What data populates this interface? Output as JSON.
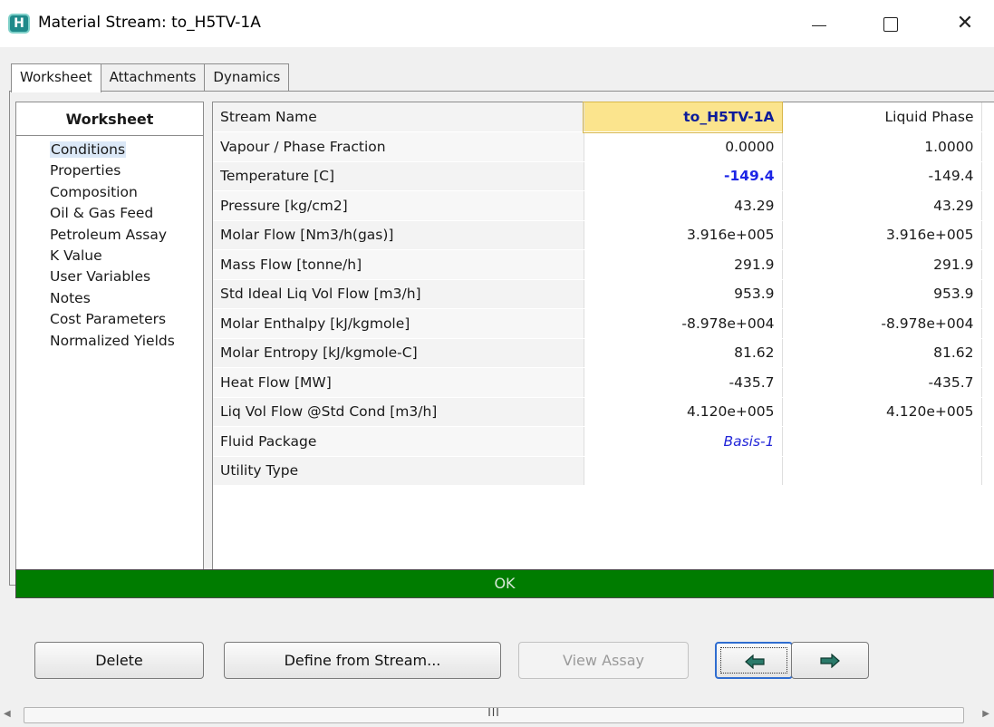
{
  "window": {
    "title": "Material Stream: to_H5TV-1A",
    "app_icon_letter": "H",
    "minimize_glyph": "",
    "maximize_glyph": "",
    "close_glyph": "✕"
  },
  "tabs": [
    {
      "label": "Worksheet",
      "active": true
    },
    {
      "label": "Attachments",
      "active": false
    },
    {
      "label": "Dynamics",
      "active": false
    }
  ],
  "nav": {
    "header": "Worksheet",
    "items": [
      {
        "label": "Conditions",
        "active": true
      },
      {
        "label": "Properties",
        "active": false
      },
      {
        "label": "Composition",
        "active": false
      },
      {
        "label": "Oil & Gas Feed",
        "active": false
      },
      {
        "label": "Petroleum Assay",
        "active": false
      },
      {
        "label": "K Value",
        "active": false
      },
      {
        "label": "User Variables",
        "active": false
      },
      {
        "label": "Notes",
        "active": false
      },
      {
        "label": "Cost Parameters",
        "active": false
      },
      {
        "label": "Normalized Yields",
        "active": false
      }
    ]
  },
  "grid": {
    "rows": [
      {
        "name": "Stream Name",
        "value": "to_H5TV-1A",
        "liquid": "Liquid Phase",
        "style": "selected"
      },
      {
        "name": "Vapour / Phase Fraction",
        "value": "0.0000",
        "liquid": "1.0000",
        "style": ""
      },
      {
        "name": "Temperature [C]",
        "value": "-149.4",
        "liquid": "-149.4",
        "style": "blue-bold"
      },
      {
        "name": "Pressure [kg/cm2]",
        "value": "43.29",
        "liquid": "43.29",
        "style": ""
      },
      {
        "name": "Molar Flow [Nm3/h(gas)]",
        "value": "3.916e+005",
        "liquid": "3.916e+005",
        "style": ""
      },
      {
        "name": "Mass Flow [tonne/h]",
        "value": "291.9",
        "liquid": "291.9",
        "style": ""
      },
      {
        "name": "Std Ideal Liq Vol Flow [m3/h]",
        "value": "953.9",
        "liquid": "953.9",
        "style": ""
      },
      {
        "name": "Molar Enthalpy [kJ/kgmole]",
        "value": "-8.978e+004",
        "liquid": "-8.978e+004",
        "style": ""
      },
      {
        "name": "Molar Entropy [kJ/kgmole-C]",
        "value": "81.62",
        "liquid": "81.62",
        "style": ""
      },
      {
        "name": "Heat Flow [MW]",
        "value": "-435.7",
        "liquid": "-435.7",
        "style": ""
      },
      {
        "name": "Liq Vol Flow @Std Cond [m3/h]",
        "value": "4.120e+005",
        "liquid": "4.120e+005",
        "style": ""
      },
      {
        "name": "Fluid Package",
        "value": "Basis-1",
        "liquid": "",
        "style": "blue-italic"
      },
      {
        "name": "Utility Type",
        "value": "",
        "liquid": "",
        "style": ""
      }
    ]
  },
  "status": {
    "text": "OK",
    "color": "#007c00"
  },
  "buttons": {
    "delete": "Delete",
    "define_from_stream": "Define from Stream...",
    "view_assay": "View Assay",
    "prev_icon": "arrow-left-icon",
    "next_icon": "arrow-right-icon"
  },
  "scrollbar": {
    "grip": "III"
  },
  "colors": {
    "selected_cell": "#fbe48d",
    "specified_value": "#1c25e6",
    "arrow": "#2a7a6a"
  }
}
